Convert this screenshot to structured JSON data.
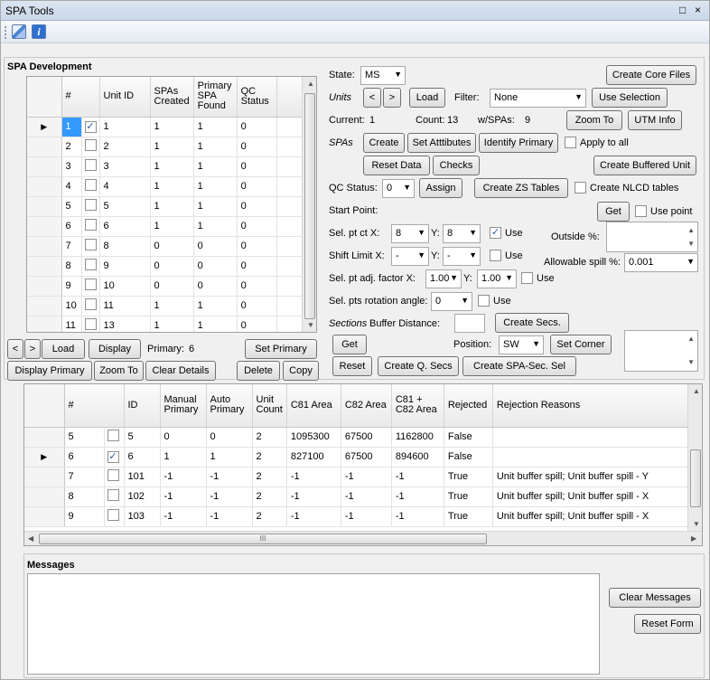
{
  "window": {
    "title": "SPA Tools",
    "maximize_glyph": "□",
    "close_glyph": "×"
  },
  "toolbar": {
    "icons": [
      "map-icon",
      "info-icon"
    ],
    "info_glyph": "i"
  },
  "spa_dev": {
    "title": "SPA Development",
    "columns": [
      "#",
      "Unit ID",
      "SPAs Created",
      "Primary SPA Found",
      "QC Status"
    ],
    "rows": [
      {
        "num": "1",
        "checked": true,
        "unit_id": "1",
        "spas_created": "1",
        "primary": "1",
        "qc": "0",
        "selected": true
      },
      {
        "num": "2",
        "checked": false,
        "unit_id": "2",
        "spas_created": "1",
        "primary": "1",
        "qc": "0"
      },
      {
        "num": "3",
        "checked": false,
        "unit_id": "3",
        "spas_created": "1",
        "primary": "1",
        "qc": "0"
      },
      {
        "num": "4",
        "checked": false,
        "unit_id": "4",
        "spas_created": "1",
        "primary": "1",
        "qc": "0"
      },
      {
        "num": "5",
        "checked": false,
        "unit_id": "5",
        "spas_created": "1",
        "primary": "1",
        "qc": "0"
      },
      {
        "num": "6",
        "checked": false,
        "unit_id": "6",
        "spas_created": "1",
        "primary": "1",
        "qc": "0"
      },
      {
        "num": "7",
        "checked": false,
        "unit_id": "8",
        "spas_created": "0",
        "primary": "0",
        "qc": "0"
      },
      {
        "num": "8",
        "checked": false,
        "unit_id": "9",
        "spas_created": "0",
        "primary": "0",
        "qc": "0"
      },
      {
        "num": "9",
        "checked": false,
        "unit_id": "10",
        "spas_created": "0",
        "primary": "0",
        "qc": "0"
      },
      {
        "num": "10",
        "checked": false,
        "unit_id": "11",
        "spas_created": "1",
        "primary": "1",
        "qc": "0"
      },
      {
        "num": "11",
        "checked": false,
        "unit_id": "13",
        "spas_created": "1",
        "primary": "1",
        "qc": "0"
      }
    ],
    "buttons": {
      "prev": "<",
      "next": ">",
      "load": "Load",
      "display": "Display",
      "set_primary": "Set Primary",
      "display_primary": "Display Primary",
      "zoom_to": "Zoom To",
      "clear_details": "Clear Details",
      "delete": "Delete",
      "copy": "Copy"
    },
    "primary_label": "Primary:",
    "primary_value": "6"
  },
  "controls": {
    "state_label": "State:",
    "state_value": "MS",
    "create_core_files": "Create Core Files",
    "units_label": "Units",
    "units_prev": "<",
    "units_next": ">",
    "units_load": "Load",
    "filter_label": "Filter:",
    "filter_value": "None",
    "use_selection": "Use Selection",
    "current_label": "Current:",
    "current_value": "1",
    "count_label": "Count:",
    "count_value": "13",
    "wspas_label": "w/SPAs:",
    "wspas_value": "9",
    "zoom_to": "Zoom To",
    "utm_info": "UTM Info",
    "spas_label": "SPAs",
    "create": "Create",
    "set_attributes": "Set Atttibutes",
    "identify_primary": "Identify Primary",
    "apply_to_all": "Apply to all",
    "reset_data": "Reset Data",
    "checks": "Checks",
    "create_buffered_unit": "Create  Buffered Unit",
    "qc_status_label": "QC Status:",
    "qc_status_value": "0",
    "assign": "Assign",
    "create_zs_tables": "Create ZS Tables",
    "create_nlcd_tables": "Create NLCD tables",
    "start_point_label": "Start Point:",
    "get": "Get",
    "use_point": "Use point",
    "sel_pt_ctx_label": "Sel. pt ct X:",
    "sel_pt_x": "8",
    "y_label": "Y:",
    "sel_pt_y": "8",
    "use_label": "Use",
    "sel_use_checked": true,
    "outside_label": "Outside %:",
    "shift_limit_label": "Shift Limit X:",
    "shift_x": "-",
    "shift_y": "-",
    "allowable_spill_label": "Allowable spill %:",
    "allowable_spill_value": "0.001",
    "sel_pt_adj_label": "Sel. pt adj. factor X:",
    "adj_x": "1.00",
    "adj_y": "1.00",
    "rotation_label": "Sel. pts rotation angle:",
    "rotation_value": "0",
    "sections_label": "Sections",
    "buffer_distance_label": "Buffer Distance:",
    "create_secs": "Create Secs.",
    "sec_get": "Get",
    "position_label": "Position:",
    "position_value": "SW",
    "set_corner": "Set Corner",
    "reset": "Reset",
    "create_q_secs": "Create Q. Secs",
    "create_spa_sec_sel": "Create SPA-Sec. Sel"
  },
  "detail": {
    "columns": [
      "#",
      "ID",
      "Manual Primary",
      "Auto Primary",
      "Unit Count",
      "C81 Area",
      "C82 Area",
      "C81 + C82 Area",
      "Rejected",
      "Rejection Reasons"
    ],
    "rows": [
      {
        "num": "5",
        "checked": false,
        "id": "5",
        "manual": "0",
        "auto": "0",
        "count": "2",
        "c81": "1095300",
        "c82": "67500",
        "c81c82": "1162800",
        "rejected": "False",
        "reasons": ""
      },
      {
        "num": "6",
        "checked": true,
        "id": "6",
        "manual": "1",
        "auto": "1",
        "count": "2",
        "c81": "827100",
        "c82": "67500",
        "c81c82": "894600",
        "rejected": "False",
        "reasons": "",
        "selected": true
      },
      {
        "num": "7",
        "checked": false,
        "id": "101",
        "manual": "-1",
        "auto": "-1",
        "count": "2",
        "c81": "-1",
        "c82": "-1",
        "c81c82": "-1",
        "rejected": "True",
        "reasons": "Unit buffer spill; Unit buffer spill - Y"
      },
      {
        "num": "8",
        "checked": false,
        "id": "102",
        "manual": "-1",
        "auto": "-1",
        "count": "2",
        "c81": "-1",
        "c82": "-1",
        "c81c82": "-1",
        "rejected": "True",
        "reasons": "Unit buffer spill; Unit buffer spill - X"
      },
      {
        "num": "9",
        "checked": false,
        "id": "103",
        "manual": "-1",
        "auto": "-1",
        "count": "2",
        "c81": "-1",
        "c82": "-1",
        "c81c82": "-1",
        "rejected": "True",
        "reasons": "Unit buffer spill; Unit buffer spill - X"
      }
    ],
    "hscroll_glyph": "III"
  },
  "messages": {
    "title": "Messages",
    "clear_messages": "Clear Messages",
    "reset_form": "Reset Form"
  },
  "glyphs": {
    "row_marker": "▶",
    "check": "✓",
    "dropdown": "▼",
    "scroll_up": "▲",
    "scroll_down": "▼",
    "scroll_left": "◀",
    "scroll_right": "▶"
  }
}
